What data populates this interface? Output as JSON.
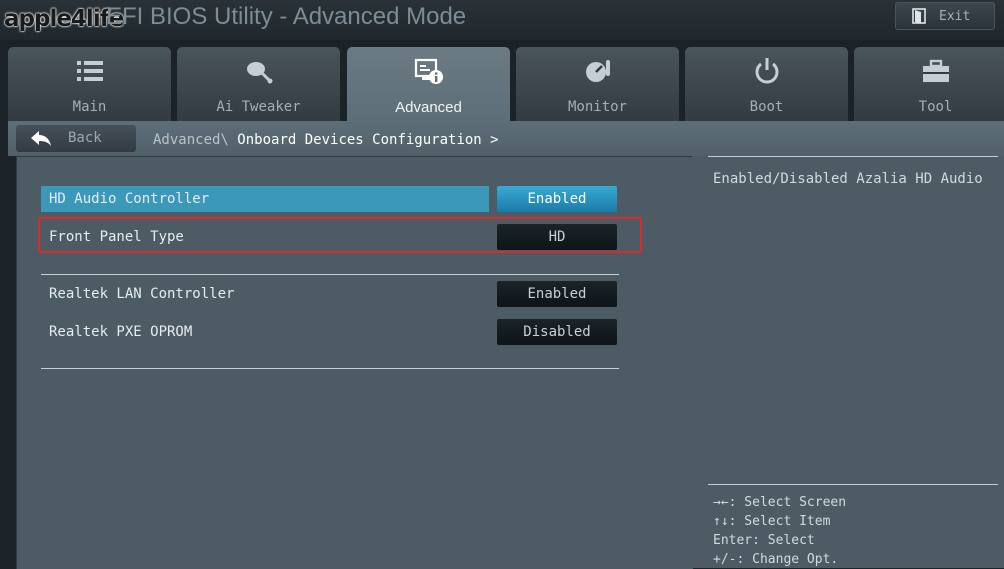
{
  "header": {
    "logo_text": "apple4life",
    "title": "EFI BIOS Utility - Advanced Mode",
    "exit_label": "Exit"
  },
  "tabs": [
    {
      "label": "Main",
      "icon": "list-icon"
    },
    {
      "label": "Ai Tweaker",
      "icon": "satellite-icon"
    },
    {
      "label": "Advanced",
      "icon": "advanced-settings-icon",
      "active": true
    },
    {
      "label": "Monitor",
      "icon": "gauge-icon"
    },
    {
      "label": "Boot",
      "icon": "power-icon"
    },
    {
      "label": "Tool",
      "icon": "toolbox-icon"
    }
  ],
  "subbar": {
    "back_label": "Back",
    "breadcrumb_parent": "Advanced\\",
    "breadcrumb_current": "Onboard Devices Configuration >"
  },
  "settings": [
    {
      "label": "HD Audio Controller",
      "value": "Enabled",
      "selected": true
    },
    {
      "label": "Front Panel Type",
      "value": "HD"
    },
    {
      "label": "Realtek LAN Controller",
      "value": "Enabled"
    },
    {
      "label": "Realtek PXE OPROM",
      "value": "Disabled"
    }
  ],
  "help": {
    "description": "Enabled/Disabled Azalia HD Audio",
    "key_hints": [
      "→←: Select Screen",
      "↑↓: Select Item",
      "Enter: Select",
      "+/-: Change Opt."
    ]
  },
  "colors": {
    "accent": "#3c98b8",
    "highlight_border": "#d92b2b",
    "panel_bg": "#4c5b64"
  }
}
